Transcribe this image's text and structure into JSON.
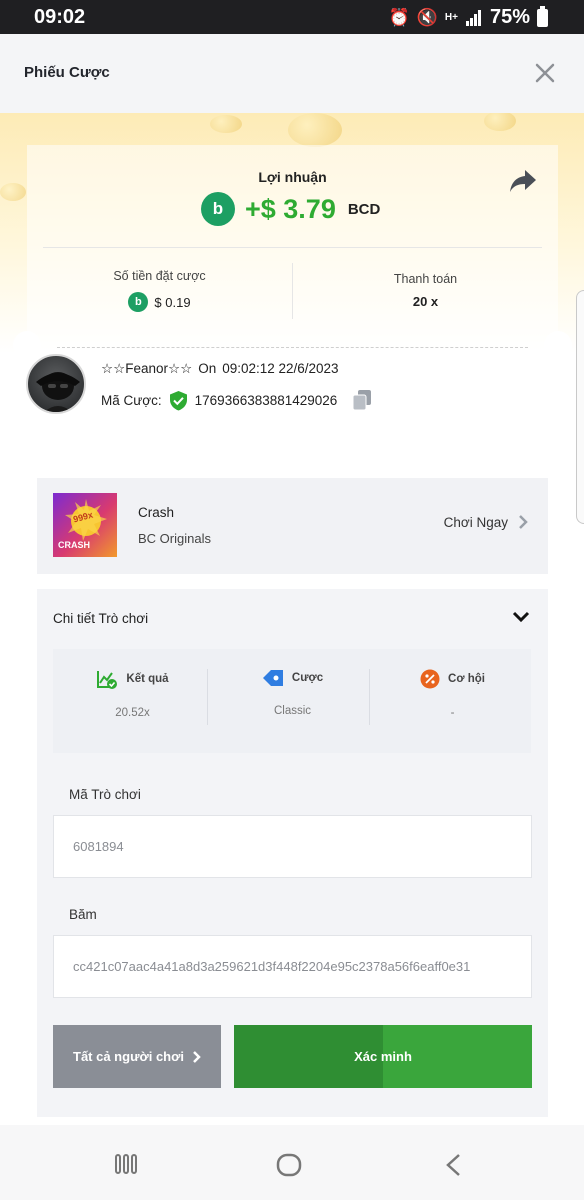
{
  "status_bar": {
    "time": "09:02",
    "network": "H+",
    "battery": "75%"
  },
  "header": {
    "title": "Phiếu Cược"
  },
  "profit": {
    "label": "Lợi nhuận",
    "value": "+$ 3.79",
    "currency": "BCD"
  },
  "stats": {
    "bet_amount_label": "Số tiền đặt cược",
    "bet_amount_value": "$ 0.19",
    "payout_label": "Thanh toán",
    "payout_value": "20 x"
  },
  "user": {
    "name": "☆☆Feanor☆☆",
    "on_label": "On",
    "datetime": "09:02:12 22/6/2023",
    "bet_id_label": "Mã Cược:",
    "bet_id": "1769366383881429026"
  },
  "game": {
    "name": "Crash",
    "provider": "BC Originals",
    "play_label": "Chơi Ngay",
    "thumb_badge": "999x",
    "thumb_text": "CRASH"
  },
  "details": {
    "title": "Chi tiết Trò chơi",
    "result_label": "Kết quả",
    "result_value": "20.52x",
    "bet_label": "Cược",
    "bet_value": "Classic",
    "odds_label": "Cơ hội",
    "odds_value": "-",
    "game_id_label": "Mã Trò chơi",
    "game_id_value": "6081894",
    "hash_label": "Băm",
    "hash_value": "cc421c07aac4a41a8d3a259621d3f448f2204e95c2378a56f6eaff0e31"
  },
  "buttons": {
    "all_players": "Tất cả người chơi",
    "verify": "Xác minh"
  },
  "colors": {
    "green": "#2eab32",
    "bc_green": "#1d9f63",
    "button_gray": "#8a8e96"
  }
}
